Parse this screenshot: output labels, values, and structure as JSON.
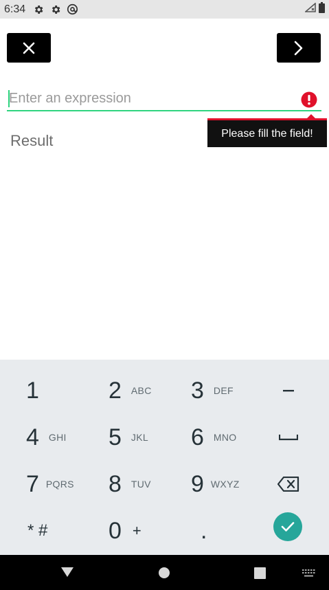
{
  "status_bar": {
    "time": "6:34",
    "icons": [
      "gear-icon",
      "gear-icon",
      "at-icon"
    ],
    "right_icons": [
      "signal-icon",
      "battery-icon"
    ]
  },
  "toolbar": {
    "close_icon": "close-icon",
    "next_icon": "chevron-right-icon"
  },
  "expression": {
    "placeholder": "Enter an expression",
    "value": "",
    "error_icon": "error-icon",
    "error_tooltip": "Please fill the field!",
    "accent_color": "#2ed47f",
    "error_color": "#e0112b"
  },
  "result": {
    "label": "Result"
  },
  "keyboard": {
    "rows": [
      [
        {
          "main": "1",
          "sub": ""
        },
        {
          "main": "2",
          "sub": "ABC"
        },
        {
          "main": "3",
          "sub": "DEF"
        },
        {
          "main": "–",
          "sub": ""
        }
      ],
      [
        {
          "main": "4",
          "sub": "GHI"
        },
        {
          "main": "5",
          "sub": "JKL"
        },
        {
          "main": "6",
          "sub": "MNO"
        },
        {
          "main": "␣",
          "sub": ""
        }
      ],
      [
        {
          "main": "7",
          "sub": "PQRS"
        },
        {
          "main": "8",
          "sub": "TUV"
        },
        {
          "main": "9",
          "sub": "WXYZ"
        },
        {
          "main": "⌫",
          "sub": ""
        }
      ],
      [
        {
          "main": "* #",
          "sub": ""
        },
        {
          "main": "0",
          "sub": "+"
        },
        {
          "main": ".",
          "sub": ""
        },
        {
          "main": "✓",
          "sub": ""
        }
      ]
    ],
    "done_color": "#26a69a"
  },
  "nav_bar": {
    "items": [
      "back-icon",
      "home-icon",
      "recents-icon",
      "keyboard-switch-icon"
    ]
  }
}
